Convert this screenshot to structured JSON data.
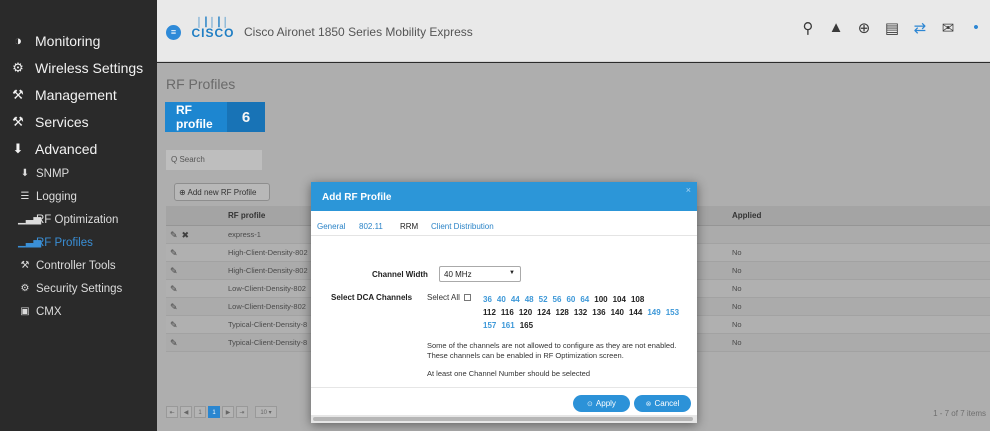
{
  "sidebar": {
    "top": [
      {
        "icon": "gauge-icon",
        "glyph": "◑",
        "label": "Monitoring"
      },
      {
        "icon": "gear-icon",
        "glyph": "⚙",
        "label": "Wireless Settings"
      },
      {
        "icon": "management-icon",
        "glyph": "⚒",
        "label": "Management"
      },
      {
        "icon": "wrench-icon",
        "glyph": "⚒",
        "label": "Services"
      },
      {
        "icon": "download-icon",
        "glyph": "⬇",
        "label": "Advanced"
      }
    ],
    "sub": [
      {
        "icon": "download-arrow-icon",
        "glyph": "⬇",
        "label": "SNMP"
      },
      {
        "icon": "logging-icon",
        "glyph": "☰",
        "label": "Logging"
      },
      {
        "icon": "signal-icon",
        "glyph": "▁▃▅",
        "label": "RF Optimization"
      },
      {
        "icon": "signal-icon",
        "glyph": "▁▃▅",
        "label": "RF Profiles"
      },
      {
        "icon": "wrench-icon",
        "glyph": "⚒",
        "label": "Controller Tools"
      },
      {
        "icon": "gear-icon",
        "glyph": "⚙",
        "label": "Security Settings"
      },
      {
        "icon": "cmx-icon",
        "glyph": "▣",
        "label": "CMX"
      }
    ]
  },
  "header": {
    "logo_bars": "│┃│┃│",
    "logo_word": "CISCO",
    "title": "Cisco Aironet 1850 Series Mobility Express",
    "icons": [
      {
        "name": "search-icon",
        "glyph": "⚲"
      },
      {
        "name": "alert-icon",
        "glyph": "▲"
      },
      {
        "name": "download-icon",
        "glyph": "⊕"
      },
      {
        "name": "save-icon",
        "glyph": "▤"
      },
      {
        "name": "transfer-icon",
        "glyph": "⇄"
      },
      {
        "name": "mail-icon",
        "glyph": "✉"
      },
      {
        "name": "more-icon",
        "glyph": "•"
      }
    ]
  },
  "page": {
    "title": "RF Profiles",
    "tile_label": "RF profile",
    "tile_count": "6",
    "search_placeholder": "Q Search",
    "add_button": "⊕ Add new RF Profile"
  },
  "table": {
    "columns": {
      "profile": "RF profile",
      "applied": "Applied"
    },
    "rows": [
      {
        "name": "express-1",
        "applied": "",
        "delete": true
      },
      {
        "name": "High-Client-Density-802",
        "applied": "No",
        "delete": false
      },
      {
        "name": "High-Client-Density-802",
        "applied": "No",
        "delete": false
      },
      {
        "name": "Low-Client-Density-802",
        "applied": "No",
        "delete": false
      },
      {
        "name": "Low-Client-Density-802",
        "applied": "No",
        "delete": false
      },
      {
        "name": "Typical-Client-Density-8",
        "applied": "No",
        "delete": false
      },
      {
        "name": "Typical-Client-Density-8",
        "applied": "No",
        "delete": false
      }
    ]
  },
  "pager": {
    "items": [
      "⇤",
      "◀",
      "1",
      "1",
      "▶",
      "⇥"
    ],
    "page_size": "10 ▾",
    "info": "1 - 7 of 7 items"
  },
  "modal": {
    "title": "Add RF Profile",
    "close": "×",
    "tabs": [
      "General",
      "802.11",
      "RRM",
      "Client Distribution"
    ],
    "active_tab": "RRM",
    "channel_width_label": "Channel Width",
    "channel_width_value": "40 MHz",
    "dca_label": "Select DCA Channels",
    "select_all": "Select All",
    "channel_lines": [
      [
        {
          "v": "36",
          "c": "blue"
        },
        {
          "v": "40",
          "c": "blue"
        },
        {
          "v": "44",
          "c": "blue"
        },
        {
          "v": "48",
          "c": "blue"
        },
        {
          "v": "52",
          "c": "blue"
        },
        {
          "v": "56",
          "c": "blue"
        },
        {
          "v": "60",
          "c": "blue"
        },
        {
          "v": "64",
          "c": "blue"
        },
        {
          "v": "100",
          "c": "black"
        },
        {
          "v": "104",
          "c": "black"
        },
        {
          "v": "108",
          "c": "black"
        }
      ],
      [
        {
          "v": "112",
          "c": "black"
        },
        {
          "v": "116",
          "c": "black"
        },
        {
          "v": "120",
          "c": "black"
        },
        {
          "v": "124",
          "c": "black"
        },
        {
          "v": "128",
          "c": "black"
        },
        {
          "v": "132",
          "c": "black"
        },
        {
          "v": "136",
          "c": "black"
        },
        {
          "v": "140",
          "c": "black"
        },
        {
          "v": "144",
          "c": "black"
        },
        {
          "v": "149",
          "c": "blue"
        },
        {
          "v": "153",
          "c": "blue"
        }
      ],
      [
        {
          "v": "157",
          "c": "blue"
        },
        {
          "v": "161",
          "c": "blue"
        },
        {
          "v": "165",
          "c": "black"
        }
      ]
    ],
    "note": "Some of the channels are not allowed to configure as they are not enabled. These channels can be enabled in RF Optimization screen.",
    "note2": "At least one Channel Number should be selected",
    "apply": "Apply",
    "cancel": "Cancel"
  },
  "colors": {
    "accent": "#2c96d8",
    "sidebar_bg": "#2a2a2a",
    "active_nav": "#3a8fd6"
  }
}
